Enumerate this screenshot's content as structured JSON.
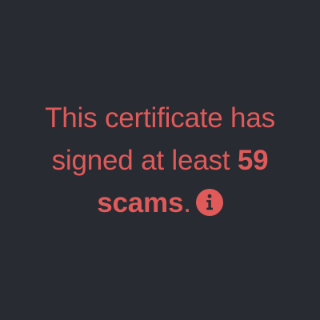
{
  "warning": {
    "text_before": "This certificate has signed at least ",
    "count": "59",
    "space": " ",
    "unit": "scams",
    "period": ".",
    "icon": "info-icon"
  },
  "colors": {
    "background": "#282b31",
    "alert_text": "#e05a5a",
    "icon_glyph": "#282b31"
  }
}
